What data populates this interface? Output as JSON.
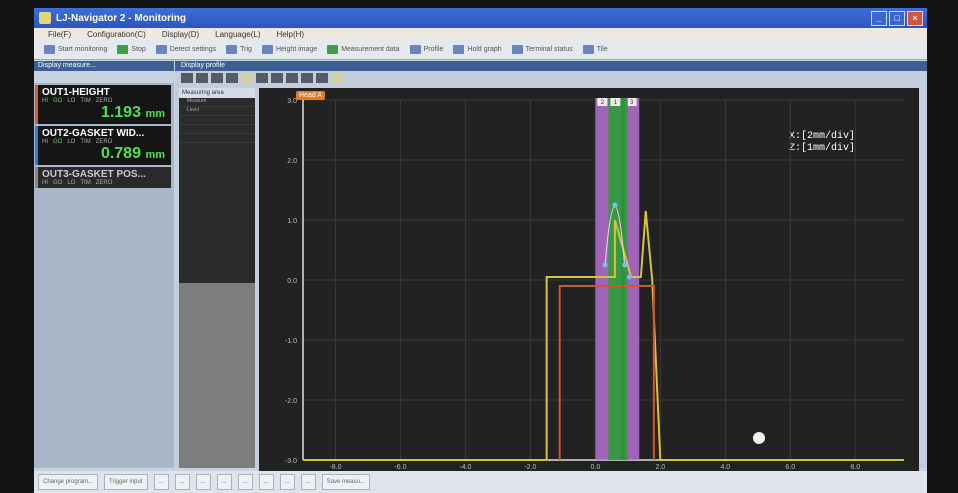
{
  "window": {
    "title": "LJ-Navigator 2 - Monitoring",
    "min": "_",
    "max": "□",
    "close": "×"
  },
  "menu": [
    "File(F)",
    "Configuration(C)",
    "Display(D)",
    "Language(L)",
    "Help(H)"
  ],
  "toolbar": [
    "Start monitoring",
    "Stop",
    "Detect settings",
    "Trig",
    "Height image",
    "Measurement data",
    "Profile",
    "Hold graph",
    "Terminal status",
    "Tile"
  ],
  "left_panel": {
    "title": "Display measure...",
    "outputs": [
      {
        "name": "OUT1-HEIGHT",
        "value": "1.193",
        "unit": "mm",
        "color": "#e0592c",
        "leds": [
          "HI",
          "GO",
          "LO",
          "TIM",
          "ZERO"
        ]
      },
      {
        "name": "OUT2-GASKET WID...",
        "value": "0.789",
        "unit": "mm",
        "color": "#2c7be0",
        "leds": [
          "HI",
          "GO",
          "LO",
          "TIM",
          "ZERO"
        ]
      },
      {
        "name": "OUT3-GASKET POS...",
        "value": "",
        "unit": "",
        "color": "#888888",
        "leds": [
          "HI",
          "GO",
          "LO",
          "TIM",
          "ZERO"
        ]
      }
    ]
  },
  "profile_panel": {
    "title": "Display profile",
    "area_header": "Measuring area",
    "area_rows": [
      "Measure",
      "Level"
    ],
    "head_label": "Head A",
    "scale_x": "X:[2mm/div]",
    "scale_z": "Z:[1mm/div]"
  },
  "chart_data": {
    "type": "line",
    "y_ticks": [
      "3.0",
      "2.0",
      "1.0",
      "0.0",
      "-1.0",
      "-2.0",
      "-3.0"
    ],
    "x_ticks": [
      "-8.0",
      "-6.0",
      "-4.0",
      "-2.0",
      "0.0",
      "2.0",
      "4.0",
      "6.0",
      "8.0"
    ],
    "ylim": [
      -3,
      3
    ],
    "xlim": [
      -9,
      9.5
    ],
    "zones": [
      {
        "label": "2",
        "x0": 0.0,
        "x1": 0.8,
        "color": "#b56fd1"
      },
      {
        "label": "3",
        "x0": 0.9,
        "x1": 1.35,
        "color": "#b56fd1"
      },
      {
        "label": "1",
        "x0": 0.4,
        "x1": 1.0,
        "color": "#2f9c3a"
      }
    ],
    "series": [
      {
        "color": "#d4c43a",
        "points": [
          [
            -9,
            -3
          ],
          [
            -1.5,
            -3
          ],
          [
            -1.5,
            0.05
          ],
          [
            0.6,
            0.05
          ],
          [
            0.6,
            1.0
          ],
          [
            1.1,
            0.05
          ],
          [
            1.4,
            0.05
          ],
          [
            1.55,
            1.15
          ],
          [
            1.75,
            0.0
          ],
          [
            2.0,
            -3
          ],
          [
            9.5,
            -3
          ]
        ]
      },
      {
        "color": "#d0572c",
        "points": [
          [
            -1.1,
            -3
          ],
          [
            -1.1,
            -0.1
          ],
          [
            1.8,
            -0.1
          ],
          [
            1.8,
            -3
          ]
        ]
      }
    ],
    "points": [
      [
        0.3,
        0.25
      ],
      [
        0.6,
        1.25
      ],
      [
        0.9,
        0.25
      ],
      [
        1.05,
        0.05
      ]
    ]
  },
  "statusbar": [
    "Change program...",
    "Trigger input",
    "...",
    "...",
    "...",
    "...",
    "...",
    "...",
    "...",
    "...",
    "Save measu..."
  ]
}
